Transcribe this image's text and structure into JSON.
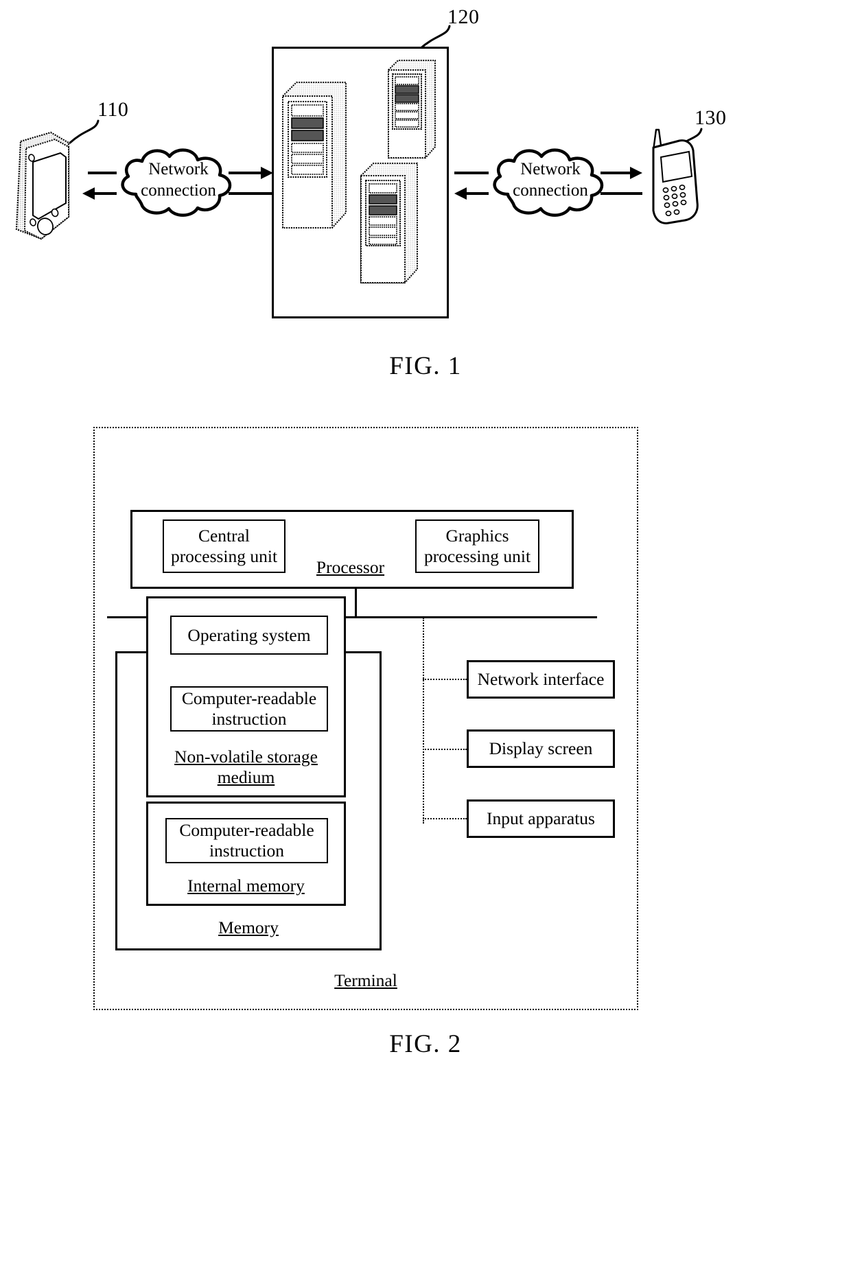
{
  "figures": [
    {
      "id": "fig1",
      "caption": "FIG. 1",
      "reference_numerals": {
        "terminal_left": "110",
        "server_cluster": "120",
        "terminal_right": "130"
      },
      "nodes": {
        "left_device": "pda-device",
        "server_box": "server-cluster-box",
        "right_device": "mobile-phone-device"
      },
      "clouds": [
        {
          "line1": "Network",
          "line2": "connection"
        },
        {
          "line1": "Network",
          "line2": "connection"
        }
      ]
    },
    {
      "id": "fig2",
      "caption": "FIG. 2",
      "terminal_label": "Terminal",
      "processor": {
        "label": "Processor",
        "units": [
          {
            "line1": "Central",
            "line2": "processing unit"
          },
          {
            "line1": "Graphics",
            "line2": "processing unit"
          }
        ]
      },
      "memory": {
        "label": "Memory",
        "non_volatile": {
          "label_line1": "Non-volatile storage",
          "label_line2": "medium",
          "items": [
            {
              "line1": "Operating system",
              "line2": ""
            },
            {
              "line1": "Computer-readable",
              "line2": "instruction"
            }
          ]
        },
        "internal": {
          "label": "Internal memory",
          "items": [
            {
              "line1": "Computer-readable",
              "line2": "instruction"
            }
          ]
        }
      },
      "peripherals": [
        {
          "label": "Network interface"
        },
        {
          "label": "Display screen"
        },
        {
          "label": "Input apparatus"
        }
      ]
    }
  ],
  "colors": {
    "ink": "#000000",
    "paper": "#ffffff",
    "shade": "#d8d8d8"
  }
}
